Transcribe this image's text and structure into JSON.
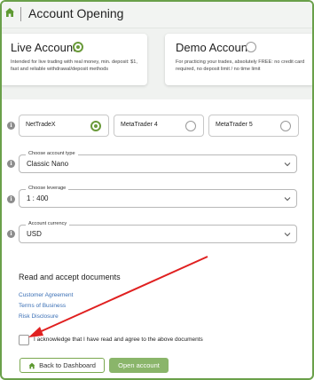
{
  "header": {
    "title": "Account Opening",
    "icon": "home-icon"
  },
  "account_types": [
    {
      "title": "Live Account",
      "description": "Intended for live trading with real money, min. deposit: $1, fast and reliable withdrawal/deposit methods",
      "selected": true
    },
    {
      "title": "Demo Account",
      "description": "For practicing your trades, absolutely FREE: no credit card required, no deposit limit / no time limit",
      "selected": false
    }
  ],
  "platforms": [
    {
      "label": "NetTradeX",
      "selected": true
    },
    {
      "label": "MetaTrader 4",
      "selected": false
    },
    {
      "label": "MetaTrader 5",
      "selected": false
    }
  ],
  "fields": {
    "account_type": {
      "legend": "Choose account type",
      "value": "Classic Nano"
    },
    "leverage": {
      "legend": "Choose leverage",
      "value": "1 : 400"
    },
    "currency": {
      "legend": "Account currency",
      "value": "USD"
    }
  },
  "documents": {
    "title": "Read and accept documents",
    "links": [
      "Customer Agreement",
      "Terms of Business",
      "Risk Disclosure"
    ],
    "acknowledge": "I acknowledge that I have read and agree to the above documents",
    "acknowledged": false
  },
  "buttons": {
    "back": "Back to Dashboard",
    "open": "Open account"
  },
  "colors": {
    "accent": "#6a9a3a",
    "link": "#3a6fb5",
    "annotation_arrow": "#e02020",
    "button_primary": "#8ab56a"
  }
}
